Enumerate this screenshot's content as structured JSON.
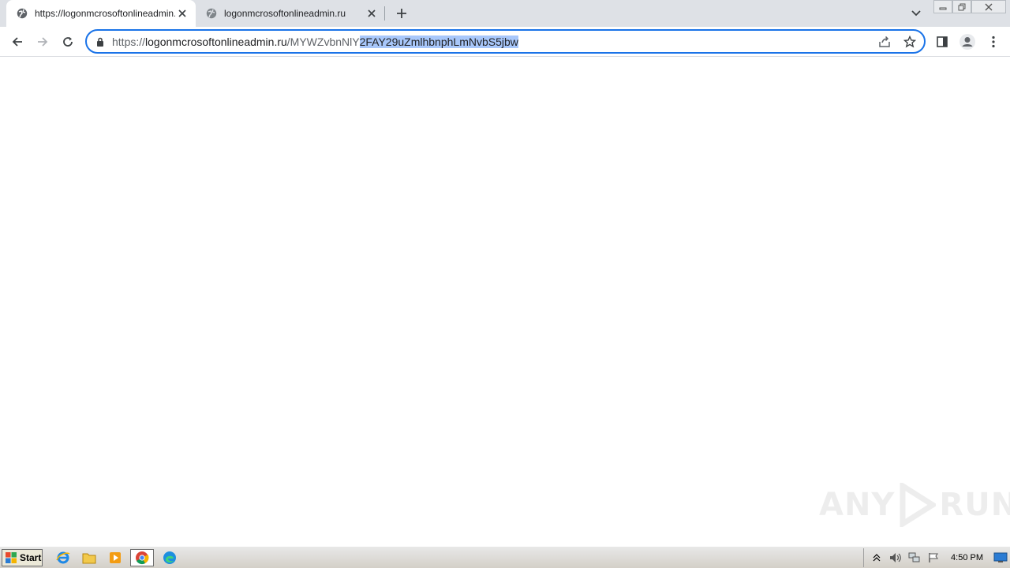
{
  "browser": {
    "tabs": [
      {
        "title": "https://logonmcrosoftonlineadmin.ru/",
        "active": true
      },
      {
        "title": "logonmcrosoftonlineadmin.ru",
        "active": false
      }
    ],
    "address": {
      "scheme": "https://",
      "host": "logonmcrosoftonlineadmin.ru",
      "path_unselected": "/MYWZvbnNlY",
      "path_selected": "2FAY29uZmlhbnphLmNvbS5jbw"
    }
  },
  "watermark": {
    "left": "ANY",
    "right": "RUN"
  },
  "taskbar": {
    "start_label": "Start",
    "clock": "4:50 PM"
  },
  "colors": {
    "accent": "#1a73e8",
    "selection": "#a8c7fa",
    "tabbar": "#dee1e6"
  }
}
